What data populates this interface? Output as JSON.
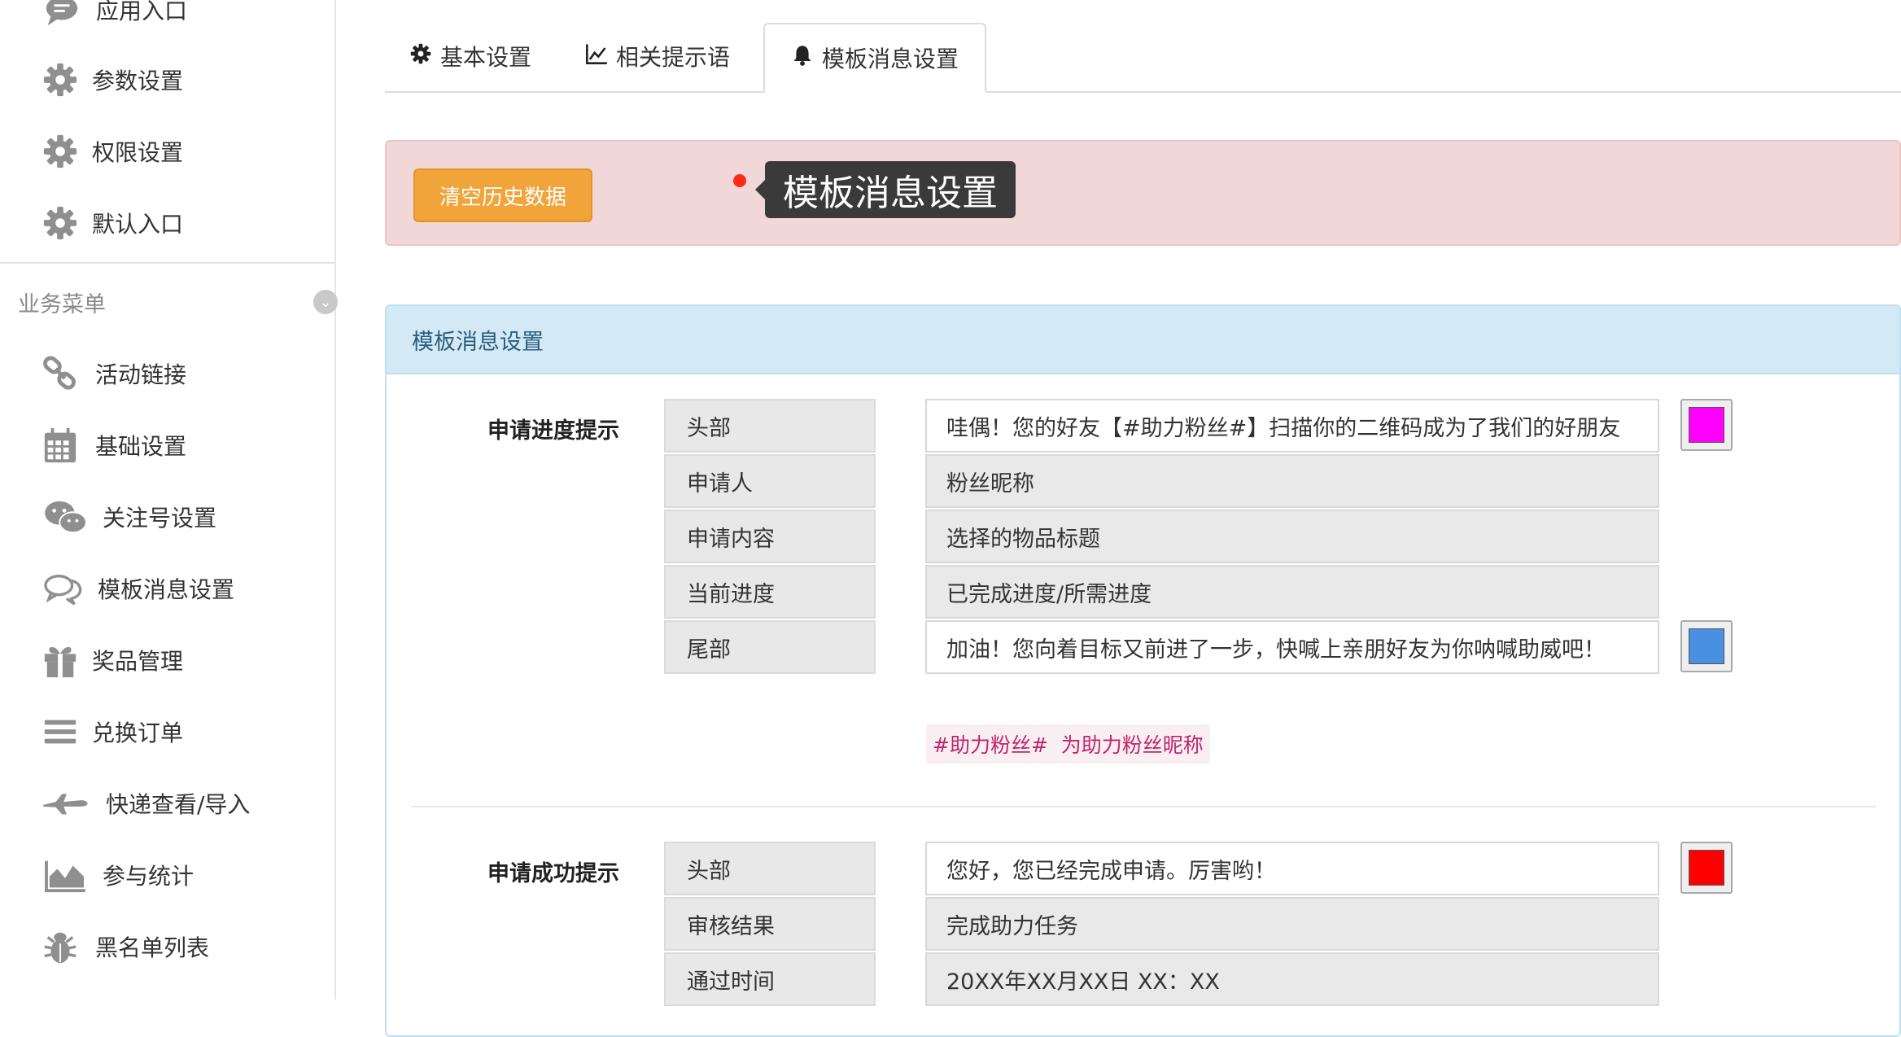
{
  "sidebar": {
    "items": [
      {
        "label": "应用入口",
        "icon": "chat-bubble-icon"
      },
      {
        "label": "参数设置",
        "icon": "gear-icon"
      },
      {
        "label": "权限设置",
        "icon": "gear-icon"
      },
      {
        "label": "默认入口",
        "icon": "gear-icon"
      },
      {
        "label": "活动链接",
        "icon": "link-icon"
      },
      {
        "label": "基础设置",
        "icon": "calendar-icon"
      },
      {
        "label": "关注号设置",
        "icon": "wechat-icon"
      },
      {
        "label": "模板消息设置",
        "icon": "comments-icon"
      },
      {
        "label": "奖品管理",
        "icon": "gift-icon"
      },
      {
        "label": "兑换订单",
        "icon": "list-icon"
      },
      {
        "label": "快递查看/导入",
        "icon": "plane-icon"
      },
      {
        "label": "参与统计",
        "icon": "area-chart-icon"
      },
      {
        "label": "黑名单列表",
        "icon": "bug-icon"
      }
    ],
    "group_label": "业务菜单"
  },
  "tabs": [
    {
      "label": "基本设置",
      "icon": "gear-icon",
      "active": false
    },
    {
      "label": "相关提示语",
      "icon": "line-chart-icon",
      "active": false
    },
    {
      "label": "模板消息设置",
      "icon": "bell-icon",
      "active": true
    }
  ],
  "alert": {
    "clear_button": "清空历史数据",
    "tooltip": "模板消息设置"
  },
  "panel": {
    "title": "模板消息设置",
    "sections": [
      {
        "title": "申请进度提示",
        "rows": [
          {
            "label": "头部",
            "value": "哇偶！您的好友【#助力粉丝#】扫描你的二维码成为了我们的好朋友",
            "editable": true,
            "color": "#ff00ff"
          },
          {
            "label": "申请人",
            "value": "粉丝昵称",
            "editable": false
          },
          {
            "label": "申请内容",
            "value": "选择的物品标题",
            "editable": false
          },
          {
            "label": "当前进度",
            "value": "已完成进度/所需进度",
            "editable": false
          },
          {
            "label": "尾部",
            "value": "加油！您向着目标又前进了一步，快喊上亲朋好友为你呐喊助威吧！",
            "editable": true,
            "color": "#4a90e2"
          }
        ],
        "hint": "#助力粉丝#  为助力粉丝昵称"
      },
      {
        "title": "申请成功提示",
        "rows": [
          {
            "label": "头部",
            "value": "您好，您已经完成申请。厉害哟！",
            "editable": true,
            "color": "#ff0000"
          },
          {
            "label": "审核结果",
            "value": "完成助力任务",
            "editable": false
          },
          {
            "label": "通过时间",
            "value": "20XX年XX月XX日 XX：XX",
            "editable": false
          }
        ]
      }
    ]
  }
}
